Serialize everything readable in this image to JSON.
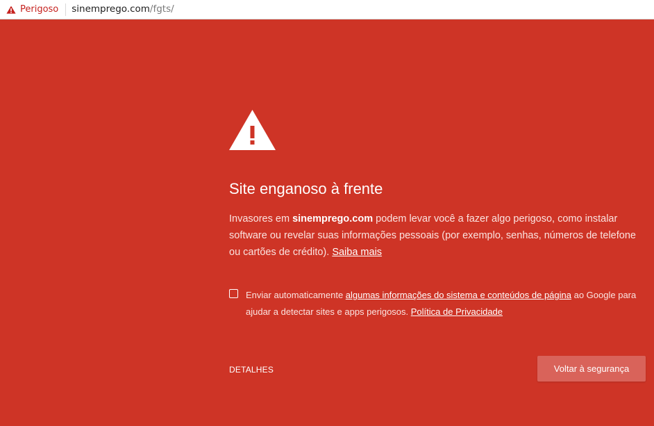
{
  "address_bar": {
    "security_label": "Perigoso",
    "url_host": "sinemprego.com",
    "url_path": "/fgts/",
    "security_icon": "warning-triangle-icon"
  },
  "interstitial": {
    "title": "Site enganoso à frente",
    "description": {
      "prefix": "Invasores em ",
      "site": "sinemprego.com",
      "middle": " podem levar você a fazer algo perigoso, como instalar software ou revelar suas informações pessoais (por exemplo, senhas, números de telefone ou cartões de crédito). ",
      "learn_more": "Saiba mais"
    },
    "opt_in": {
      "prefix": "Enviar automaticamente ",
      "link": "algumas informações do sistema e conteúdos de página",
      "middle": " ao Google para ajudar a detectar sites e apps perigosos. ",
      "privacy_link": "Política de Privacidade",
      "checked": false
    },
    "details_label": "DETALHES",
    "back_label": "Voltar à segurança"
  },
  "colors": {
    "background": "#ce3426",
    "button": "#d9635a",
    "danger_text": "#c5221f"
  }
}
